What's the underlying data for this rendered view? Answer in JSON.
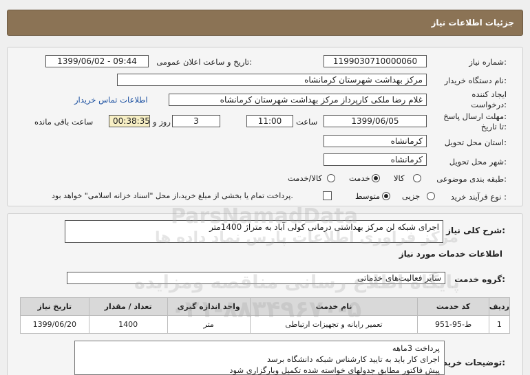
{
  "header": {
    "title": "جزئیات اطلاعات نیاز"
  },
  "form": {
    "need_number_label": "شماره نیاز:",
    "need_number": "1199030710000060",
    "announce_label": "تاریخ و ساعت اعلان عمومی:",
    "announce_value": "1399/06/02 - 09:44",
    "buyer_org_label": "نام دستگاه خریدار:",
    "buyer_org": "مرکز بهداشت شهرستان کرمانشاه",
    "creator_label_1": "ایجاد کننده",
    "creator_label_2": "درخواست:",
    "creator": "غلام رضا ملکی کارپرداز مرکز بهداشت شهرستان کرمانشاه",
    "contact_link": "اطلاعات تماس خریدار",
    "deadline_label_1": "مهلت ارسال پاسخ:",
    "deadline_label_2": "تا تاریخ:",
    "deadline_date": "1399/06/05",
    "time_label": "ساعت",
    "deadline_time": "11:00",
    "days_value": "3",
    "days_label": "روز و",
    "remaining_time": "00:38:35",
    "remaining_label": "ساعت باقی مانده",
    "province_label": "استان محل تحویل:",
    "province": "کرمانشاه",
    "city_label": "شهر محل تحویل:",
    "city": "کرمانشاه",
    "category_label": "طبقه بندی موضوعی:",
    "category_options": [
      "کالا",
      "خدمت",
      "کالا/خدمت"
    ],
    "process_label": "نوع فرآیند خرید :",
    "process_options": [
      "جزیی",
      "متوسط"
    ],
    "payment_note": "پرداخت تمام یا بخشی از مبلغ خرید،از محل \"اسناد خزانه اسلامی\" خواهد بود."
  },
  "general_desc": {
    "label": "شرح کلی نیاز:",
    "value": "اجرای شبکه لن مرکز بهداشتی درمانی کولی آباد به متراژ 1400متر"
  },
  "services": {
    "section_title": "اطلاعات خدمات مورد نیاز",
    "group_label": "گروه خدمت:",
    "group_value": "سایر فعالیت‌های خدماتی",
    "columns": [
      "ردیف",
      "کد خدمت",
      "نام خدمت",
      "واحد اندازه گیری",
      "تعداد / مقدار",
      "تاریخ نیاز"
    ],
    "rows": [
      {
        "index": "1",
        "code": "ط-95-951",
        "name": "تعمیر رایانه و تجهیزات ارتباطی",
        "unit": "متر",
        "qty": "1400",
        "date": "1399/06/20"
      }
    ]
  },
  "buyer_notes": {
    "label": "توضیحات خریدار:",
    "lines": [
      "پرداخت 3ماهه",
      "اجرای کار باید به تایید کارشناس شبکه دانشگاه برسد",
      "پیش فاکتور مطابق جدولهای خواسته شده تکمیل وبارگزاری شود"
    ]
  },
  "watermark": {
    "line1": "ParsNamadData",
    "line2": "مرکز فراوری اطلاعات پارس نماد داده ها",
    "line3": "پایگاه اطلاع رسانی مناقصه ومزایده",
    "line4": "۰۲۱-۸۸۳۴۹۶۷۰-۵"
  }
}
